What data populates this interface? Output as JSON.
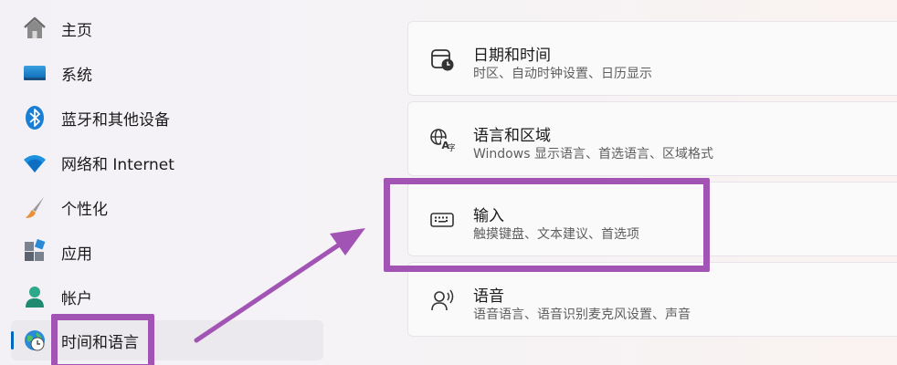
{
  "sidebar": {
    "items": [
      {
        "label": "主页",
        "icon": "home-icon"
      },
      {
        "label": "系统",
        "icon": "display-icon"
      },
      {
        "label": "蓝牙和其他设备",
        "icon": "bluetooth-icon"
      },
      {
        "label": "网络和 Internet",
        "icon": "wifi-icon"
      },
      {
        "label": "个性化",
        "icon": "brush-icon"
      },
      {
        "label": "应用",
        "icon": "apps-icon"
      },
      {
        "label": "帐户",
        "icon": "account-icon"
      },
      {
        "label": "时间和语言",
        "icon": "globe-clock-icon",
        "active": true
      }
    ]
  },
  "settings": {
    "cards": [
      {
        "title": "日期和时间",
        "subtitle": "时区、自动时钟设置、日历显示",
        "icon": "calendar-clock-icon"
      },
      {
        "title": "语言和区域",
        "subtitle": "Windows 显示语言、首选语言、区域格式",
        "icon": "language-icon"
      },
      {
        "title": "输入",
        "subtitle": "触摸键盘、文本建议、首选项",
        "icon": "keyboard-icon"
      },
      {
        "title": "语音",
        "subtitle": "语音语言、语音识别麦克风设置、声音",
        "icon": "speech-icon"
      }
    ]
  },
  "annotation": {
    "color": "#a254b4"
  },
  "colors": {
    "accent": "#0067c0"
  }
}
